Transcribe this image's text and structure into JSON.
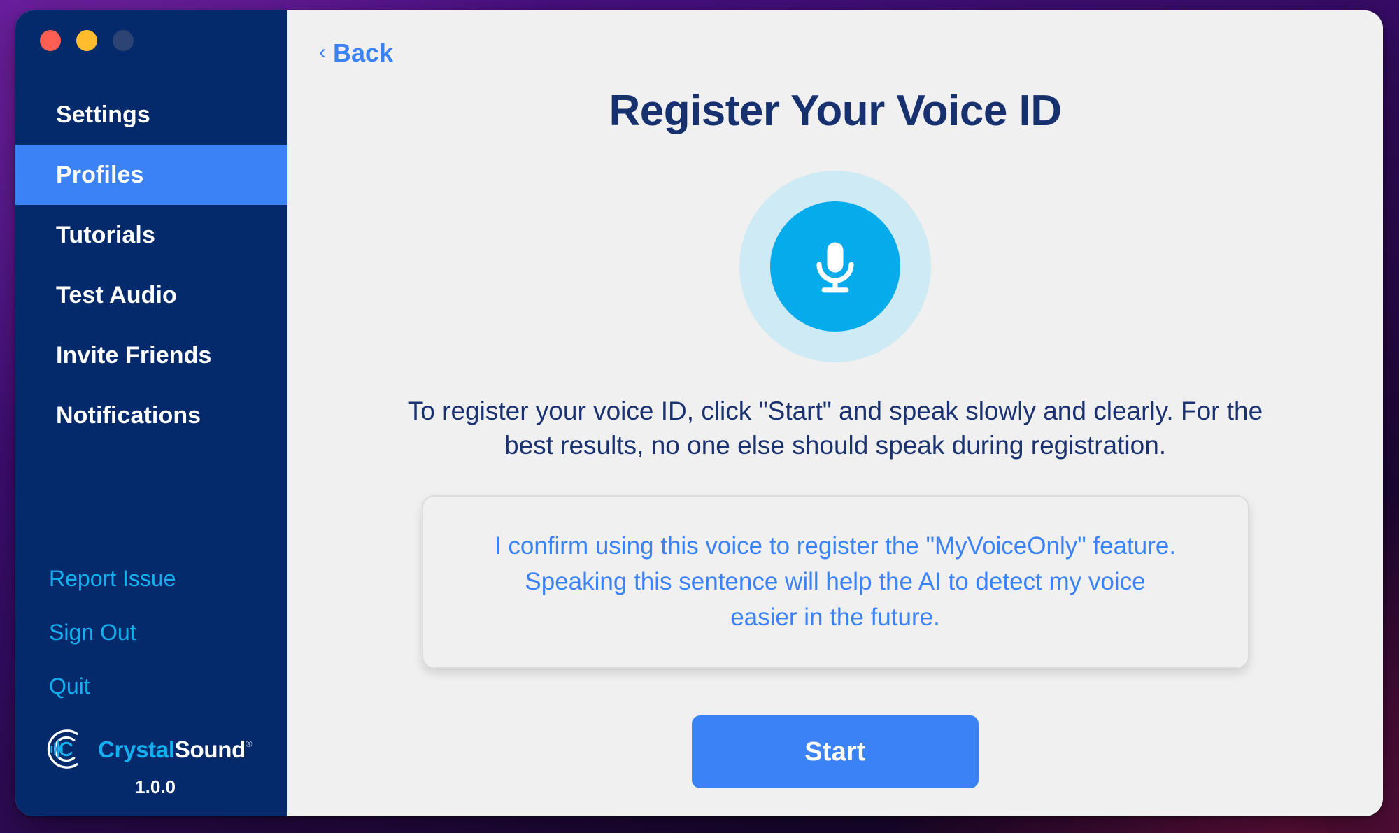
{
  "window": {
    "controls": [
      {
        "name": "close",
        "color": "#ff5f52"
      },
      {
        "name": "minimize",
        "color": "#ffbd2e"
      },
      {
        "name": "zoom",
        "color": "#2c4373"
      }
    ]
  },
  "sidebar": {
    "background_color": "#042a6b",
    "active_color": "#3b82f6",
    "link_color": "#13b0ef",
    "items": [
      {
        "label": "Settings",
        "active": false
      },
      {
        "label": "Profiles",
        "active": true
      },
      {
        "label": "Tutorials",
        "active": false
      },
      {
        "label": "Test Audio",
        "active": false
      },
      {
        "label": "Invite Friends",
        "active": false
      },
      {
        "label": "Notifications",
        "active": false
      }
    ],
    "links": [
      {
        "label": "Report Issue"
      },
      {
        "label": "Sign Out"
      },
      {
        "label": "Quit"
      }
    ],
    "brand": {
      "icon": "soundwave-circle-icon",
      "name_part_one": "Crystal",
      "name_part_two": "Sound",
      "trademark": "®",
      "version": "1.0.0"
    }
  },
  "main": {
    "back": {
      "chevron": "‹",
      "label": "Back"
    },
    "title": "Register Your Voice ID",
    "mic_icon": "microphone-icon",
    "mic_color": "#06abeb",
    "mic_halo_color": "#cdeaf5",
    "instructions": "To register your voice ID, click \"Start\" and speak slowly and clearly. For the best results, no one else should speak during registration.",
    "confirm_sentence": "I confirm using this voice to register the \"MyVoiceOnly\" feature. Speaking this sentence will help the AI to detect my voice easier in the future.",
    "start_button_label": "Start",
    "start_button_color": "#3b82f6",
    "title_color": "#17306e"
  }
}
